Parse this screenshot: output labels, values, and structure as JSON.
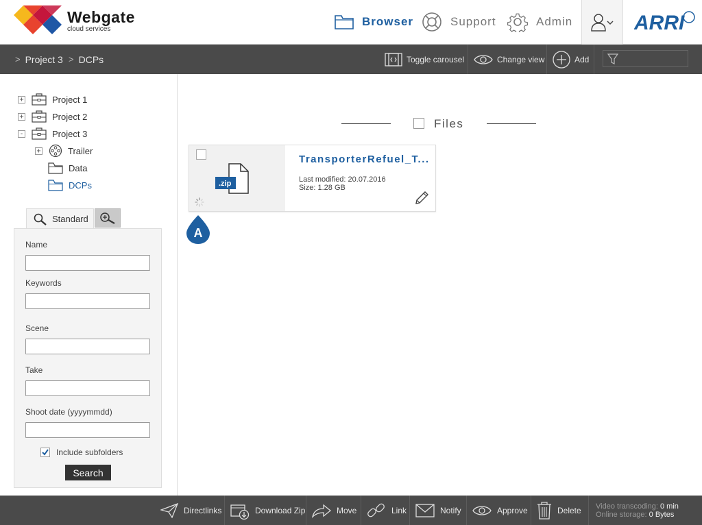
{
  "brand": {
    "title": "Webgate",
    "subtitle": "cloud services",
    "logo_colors": [
      "#e8432e",
      "#f6b81d",
      "#c4163c",
      "#1f57a6"
    ],
    "partner_logo": "ARRI"
  },
  "nav": {
    "browser": "Browser",
    "support": "Support",
    "admin": "Admin",
    "active_color": "#1e5fa0"
  },
  "breadcrumb": [
    "Project 3",
    "DCPs"
  ],
  "toolbar": {
    "toggle_carousel": "Toggle carousel",
    "change_view": "Change view",
    "add": "Add",
    "filter_placeholder": ""
  },
  "tree": {
    "items": [
      {
        "label": "Project 1",
        "toggle": "+",
        "icon": "project-icon"
      },
      {
        "label": "Project 2",
        "toggle": "+",
        "icon": "project-icon"
      },
      {
        "label": "Project 3",
        "toggle": "-",
        "icon": "project-icon"
      },
      {
        "label": "Trailer",
        "toggle": "+",
        "icon": "film-reel-icon"
      },
      {
        "label": "Data",
        "toggle": "",
        "icon": "folder-icon"
      },
      {
        "label": "DCPs",
        "toggle": "",
        "icon": "folder-icon",
        "active": true
      }
    ]
  },
  "search": {
    "tab_standard": "Standard",
    "fields": {
      "name": {
        "label": "Name",
        "value": ""
      },
      "keywords": {
        "label": "Keywords",
        "value": ""
      },
      "scene": {
        "label": "Scene",
        "value": ""
      },
      "take": {
        "label": "Take",
        "value": ""
      },
      "shoot_date": {
        "label": "Shoot date (yyyymmdd)",
        "value": ""
      }
    },
    "include_subfolders": "Include subfolders",
    "include_subfolders_checked": true,
    "button": "Search"
  },
  "files": {
    "header": "Files",
    "items": [
      {
        "title": "TransporterRefuel_T...",
        "badge": ".zip",
        "modified": "Last modified: 20.07.2016",
        "size": "Size: 1.28 GB",
        "marker": "A"
      }
    ]
  },
  "bottom": {
    "directlinks": "Directlinks",
    "download_zip": "Download Zip",
    "move": "Move",
    "link": "Link",
    "notify": "Notify",
    "approve": "Approve",
    "delete": "Delete",
    "video_transcoding_label": "Video transcoding:",
    "video_transcoding_value": "0 min",
    "online_storage_label": "Online storage:",
    "online_storage_value": "0 Bytes"
  }
}
